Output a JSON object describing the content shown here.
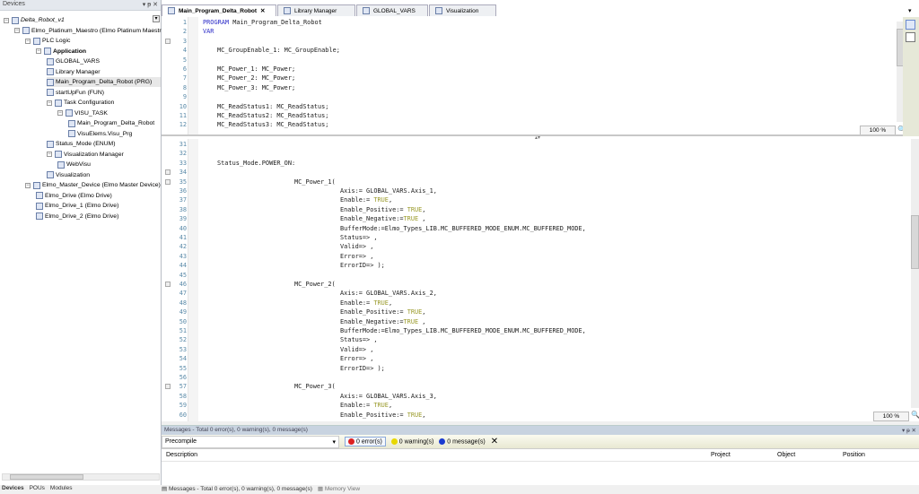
{
  "devices_panel": {
    "title": "Devices",
    "controls": [
      "▾",
      "ᵽ",
      "✕"
    ],
    "tree": [
      {
        "label": "Delta_Robot_v1",
        "depth": 0,
        "italic": true,
        "toggle": "−",
        "icon": "project-icon"
      },
      {
        "label": "Elmo_Platinum_Maestro (Elmo Platinum Maestro)",
        "depth": 1,
        "toggle": "−",
        "icon": "device-icon"
      },
      {
        "label": "PLC Logic",
        "depth": 2,
        "toggle": "−",
        "icon": "plc-logic-icon"
      },
      {
        "label": "Application",
        "depth": 3,
        "bold": true,
        "toggle": "−",
        "icon": "gear-icon"
      },
      {
        "label": "GLOBAL_VARS",
        "depth": 4,
        "icon": "globe-icon"
      },
      {
        "label": "Library Manager",
        "depth": 4,
        "icon": "library-icon"
      },
      {
        "label": "Main_Program_Delta_Robot (PRG)",
        "depth": 4,
        "icon": "program-icon",
        "selected": true
      },
      {
        "label": "startUpFun (FUN)",
        "depth": 4,
        "icon": "function-icon"
      },
      {
        "label": "Task Configuration",
        "depth": 4,
        "toggle": "−",
        "icon": "task-config-icon"
      },
      {
        "label": "VISU_TASK",
        "depth": 5,
        "toggle": "−",
        "icon": "task-icon"
      },
      {
        "label": "Main_Program_Delta_Robot",
        "depth": 6,
        "icon": "program-call-icon"
      },
      {
        "label": "VisuElems.Visu_Prg",
        "depth": 6,
        "icon": "program-call-icon"
      },
      {
        "label": "Status_Mode (ENUM)",
        "depth": 4,
        "icon": "enum-icon"
      },
      {
        "label": "Visualization Manager",
        "depth": 4,
        "toggle": "−",
        "icon": "visu-manager-icon"
      },
      {
        "label": "WebVisu",
        "depth": 5,
        "icon": "webvisu-icon"
      },
      {
        "label": "Visualization",
        "depth": 4,
        "icon": "visualization-icon"
      },
      {
        "label": "Elmo_Master_Device (Elmo Master Device)",
        "depth": 2,
        "toggle": "−",
        "icon": "master-device-icon"
      },
      {
        "label": "Elmo_Drive (Elmo Drive)",
        "depth": 3,
        "icon": "drive-icon"
      },
      {
        "label": "Elmo_Drive_1 (Elmo Drive)",
        "depth": 3,
        "icon": "drive-icon"
      },
      {
        "label": "Elmo_Drive_2 (Elmo Drive)",
        "depth": 3,
        "icon": "drive-icon"
      }
    ],
    "tabs": [
      "Devices",
      "POUs",
      "Modules"
    ]
  },
  "editor": {
    "tabs": [
      {
        "label": "Main_Program_Delta_Robot",
        "active": true,
        "close": "✕"
      },
      {
        "label": "Library Manager"
      },
      {
        "label": "GLOBAL_VARS"
      },
      {
        "label": "Visualization"
      }
    ],
    "zoom_top": "100 %",
    "zoom_bottom": "100 %",
    "decl": [
      {
        "n": 1,
        "i": 0,
        "s": [
          [
            "PROGRAM",
            "kw"
          ],
          [
            " Main_Program_Delta_Robot",
            ""
          ]
        ]
      },
      {
        "n": 2,
        "i": 0,
        "s": [
          [
            "VAR",
            "kw"
          ]
        ]
      },
      {
        "n": 3,
        "i": 0,
        "s": [],
        "fold": true
      },
      {
        "n": 4,
        "i": 1,
        "s": [
          [
            "MC_GroupEnable_1: MC_GroupEnable;",
            ""
          ]
        ]
      },
      {
        "n": 5,
        "i": 0,
        "s": []
      },
      {
        "n": 6,
        "i": 1,
        "s": [
          [
            "MC_Power_1: MC_Power;",
            ""
          ]
        ]
      },
      {
        "n": 7,
        "i": 1,
        "s": [
          [
            "MC_Power_2: MC_Power;",
            ""
          ]
        ]
      },
      {
        "n": 8,
        "i": 1,
        "s": [
          [
            "MC_Power_3: MC_Power;",
            ""
          ]
        ]
      },
      {
        "n": 9,
        "i": 0,
        "s": []
      },
      {
        "n": 10,
        "i": 1,
        "s": [
          [
            "MC_ReadStatus1: MC_ReadStatus;",
            ""
          ]
        ]
      },
      {
        "n": 11,
        "i": 1,
        "s": [
          [
            "MC_ReadStatus2: MC_ReadStatus;",
            ""
          ]
        ]
      },
      {
        "n": 12,
        "i": 1,
        "s": [
          [
            "MC_ReadStatus3: MC_ReadStatus;",
            ""
          ]
        ]
      }
    ],
    "body": [
      {
        "n": 31,
        "i": 0,
        "s": []
      },
      {
        "n": 32,
        "i": 0,
        "s": []
      },
      {
        "n": 33,
        "i": 1,
        "s": [
          [
            "Status_Mode.POWER_ON:",
            ""
          ]
        ]
      },
      {
        "n": 34,
        "i": 0,
        "s": [],
        "fold": true
      },
      {
        "n": 35,
        "i": 2,
        "s": [
          [
            "MC_Power_1(",
            ""
          ]
        ],
        "fold": true
      },
      {
        "n": 36,
        "i": 3,
        "s": [
          [
            "Axis:= GLOBAL_VARS.Axis_1,",
            ""
          ]
        ]
      },
      {
        "n": 37,
        "i": 3,
        "s": [
          [
            "Enable:= ",
            ""
          ],
          [
            "TRUE",
            "lit"
          ],
          [
            ",",
            ""
          ]
        ]
      },
      {
        "n": 38,
        "i": 3,
        "s": [
          [
            "Enable_Positive:= ",
            ""
          ],
          [
            "TRUE",
            "lit"
          ],
          [
            ",",
            ""
          ]
        ]
      },
      {
        "n": 39,
        "i": 3,
        "s": [
          [
            "Enable_Negative:=",
            ""
          ],
          [
            "TRUE",
            "lit"
          ],
          [
            " ,",
            ""
          ]
        ]
      },
      {
        "n": 40,
        "i": 3,
        "s": [
          [
            "BufferMode:=Elmo_Types_LIB.MC_BUFFERED_MODE_ENUM.MC_BUFFERED_MODE,",
            ""
          ]
        ]
      },
      {
        "n": 41,
        "i": 3,
        "s": [
          [
            "Status=> ,",
            ""
          ]
        ]
      },
      {
        "n": 42,
        "i": 3,
        "s": [
          [
            "Valid=> ,",
            ""
          ]
        ]
      },
      {
        "n": 43,
        "i": 3,
        "s": [
          [
            "Error=> ,",
            ""
          ]
        ]
      },
      {
        "n": 44,
        "i": 3,
        "s": [
          [
            "ErrorID=> );",
            ""
          ]
        ]
      },
      {
        "n": 45,
        "i": 0,
        "s": []
      },
      {
        "n": 46,
        "i": 2,
        "s": [
          [
            "MC_Power_2(",
            ""
          ]
        ],
        "fold": true
      },
      {
        "n": 47,
        "i": 3,
        "s": [
          [
            "Axis:= GLOBAL_VARS.Axis_2,",
            ""
          ]
        ]
      },
      {
        "n": 48,
        "i": 3,
        "s": [
          [
            "Enable:= ",
            ""
          ],
          [
            "TRUE",
            "lit"
          ],
          [
            ",",
            ""
          ]
        ]
      },
      {
        "n": 49,
        "i": 3,
        "s": [
          [
            "Enable_Positive:= ",
            ""
          ],
          [
            "TRUE",
            "lit"
          ],
          [
            ",",
            ""
          ]
        ]
      },
      {
        "n": 50,
        "i": 3,
        "s": [
          [
            "Enable_Negative:=",
            ""
          ],
          [
            "TRUE",
            "lit"
          ],
          [
            " ,",
            ""
          ]
        ]
      },
      {
        "n": 51,
        "i": 3,
        "s": [
          [
            "BufferMode:=Elmo_Types_LIB.MC_BUFFERED_MODE_ENUM.MC_BUFFERED_MODE,",
            ""
          ]
        ]
      },
      {
        "n": 52,
        "i": 3,
        "s": [
          [
            "Status=> ,",
            ""
          ]
        ]
      },
      {
        "n": 53,
        "i": 3,
        "s": [
          [
            "Valid=> ,",
            ""
          ]
        ]
      },
      {
        "n": 54,
        "i": 3,
        "s": [
          [
            "Error=> ,",
            ""
          ]
        ]
      },
      {
        "n": 55,
        "i": 3,
        "s": [
          [
            "ErrorID=> );",
            ""
          ]
        ]
      },
      {
        "n": 56,
        "i": 0,
        "s": []
      },
      {
        "n": 57,
        "i": 2,
        "s": [
          [
            "MC_Power_3(",
            ""
          ]
        ],
        "fold": true
      },
      {
        "n": 58,
        "i": 3,
        "s": [
          [
            "Axis:= GLOBAL_VARS.Axis_3,",
            ""
          ]
        ]
      },
      {
        "n": 59,
        "i": 3,
        "s": [
          [
            "Enable:= ",
            ""
          ],
          [
            "TRUE",
            "lit"
          ],
          [
            ",",
            ""
          ]
        ]
      },
      {
        "n": 60,
        "i": 3,
        "s": [
          [
            "Enable_Positive:= ",
            ""
          ],
          [
            "TRUE",
            "lit"
          ],
          [
            ",",
            ""
          ]
        ]
      }
    ]
  },
  "messages": {
    "title": "Messages - Total 0 error(s), 0 warning(s), 0 message(s)",
    "filter": "Precompile",
    "errors": "0 error(s)",
    "warnings": "0 warning(s)",
    "infos": "0 message(s)",
    "columns": [
      "Description",
      "Project",
      "Object",
      "Position"
    ],
    "controls": [
      "▾",
      "ᵽ",
      "✕"
    ]
  },
  "bottom_tabs": [
    "Messages - Total 0 error(s), 0 warning(s), 0 message(s)",
    "Memory View"
  ]
}
